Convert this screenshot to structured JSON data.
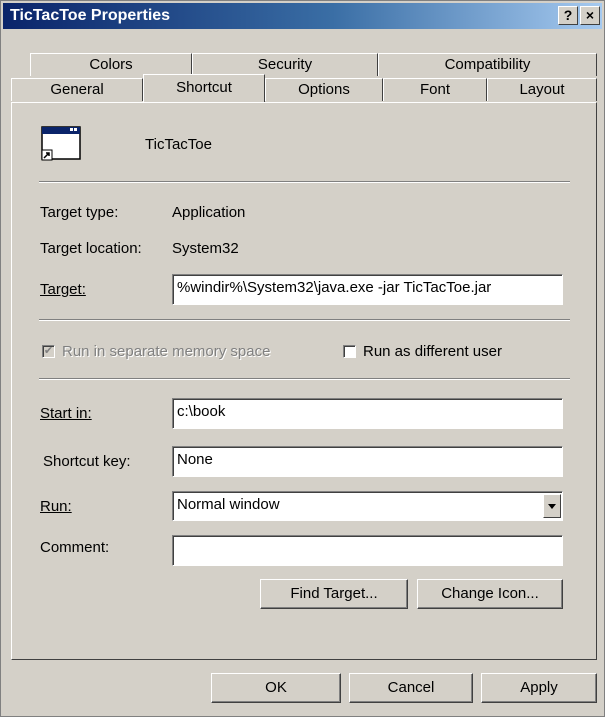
{
  "window": {
    "title": "TicTacToe Properties"
  },
  "titlebar_buttons": {
    "help": "?",
    "close": "×"
  },
  "tabs": {
    "row1": [
      "Colors",
      "Security",
      "Compatibility"
    ],
    "row2": [
      "General",
      "Shortcut",
      "Options",
      "Font",
      "Layout"
    ],
    "active": "Shortcut"
  },
  "shortcut": {
    "name": "TicTacToe",
    "icon": "shortcut-app-icon",
    "target_type_label": "Target type:",
    "target_type_value": "Application",
    "target_location_label": "Target location:",
    "target_location_value": "System32",
    "target_label": "Target:",
    "target_value": "%windir%\\System32\\java.exe -jar TicTacToe.jar",
    "run_separate_label": "Run in separate memory space",
    "run_separate_checked": true,
    "run_as_label": "Run as different user",
    "run_as_checked": false,
    "start_in_label": "Start in:",
    "start_in_value": "c:\\book",
    "shortcut_key_label": "Shortcut key:",
    "shortcut_key_value": "None",
    "run_label": "Run:",
    "run_value": "Normal window",
    "comment_label": "Comment:",
    "comment_value": "",
    "find_target_label": "Find Target...",
    "change_icon_label": "Change Icon..."
  },
  "footer": {
    "ok": "OK",
    "cancel": "Cancel",
    "apply": "Apply"
  },
  "colors": {
    "titlebar_start": "#0a246a",
    "titlebar_end": "#a6caf0",
    "face": "#d4d0c8"
  }
}
